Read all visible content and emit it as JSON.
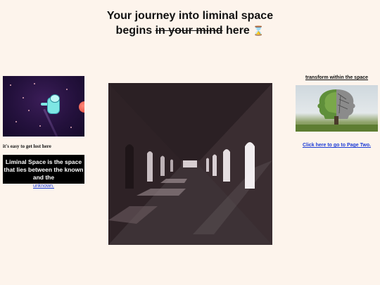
{
  "heading": {
    "line1": "Your journey into liminal space",
    "line2_start": "begins",
    "line2_struck": "in your mind",
    "line2_end": "here",
    "hourglass": "⌛"
  },
  "left": {
    "caption": "it's easy to get lost here",
    "definition": "Liminal Space is the space that lies between the known and the",
    "definition_link": "unknown."
  },
  "right": {
    "caption": "transform within the space",
    "page_link": "Click here to go to Page Two."
  },
  "icons": {
    "hourglass": "hourglass-icon"
  }
}
